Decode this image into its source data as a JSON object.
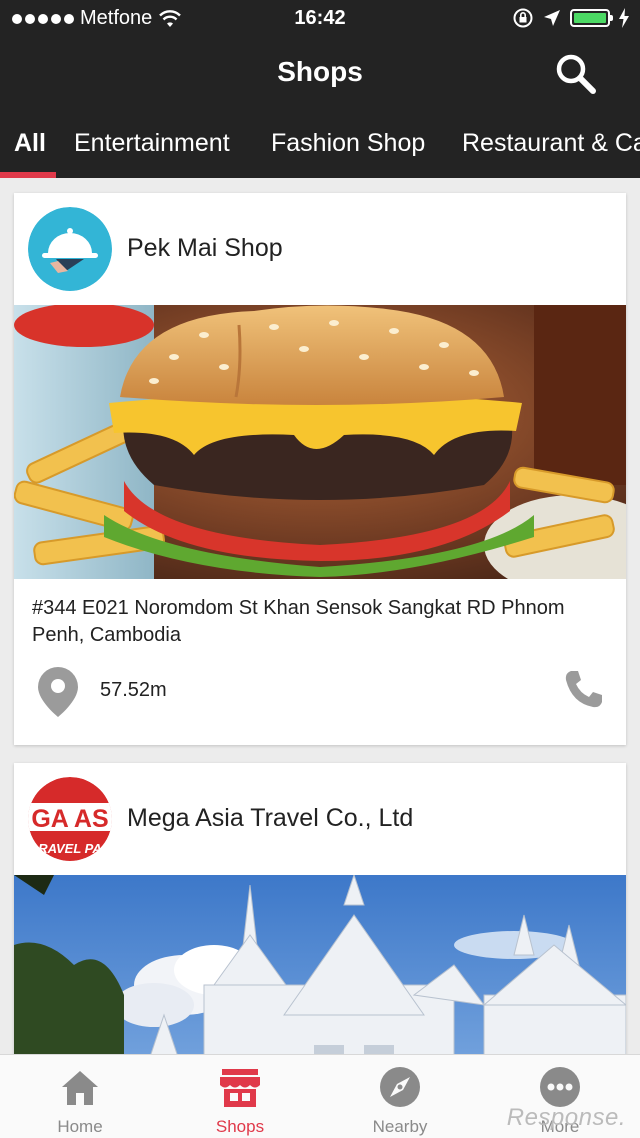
{
  "status_bar": {
    "carrier": "Metfone",
    "time": "16:42",
    "icons": [
      "signal-dots-icon",
      "wifi-icon",
      "orientation-lock-icon",
      "location-arrow-icon",
      "battery-icon",
      "charging-bolt-icon"
    ],
    "battery_level": 1.0
  },
  "header": {
    "title": "Shops",
    "search_icon": "search-icon"
  },
  "tabs": {
    "items": [
      {
        "label": "All",
        "active": true
      },
      {
        "label": "Entertainment",
        "active": false
      },
      {
        "label": "Fashion Shop",
        "active": false
      },
      {
        "label": "Restaurant & Ca",
        "active": false
      }
    ]
  },
  "shops": [
    {
      "name": "Pek Mai Shop",
      "logo": "food-service-cloche-icon",
      "image": "burger-photo",
      "address": "#344 E021 Noromdom St Khan Sensok Sangkat RD Phnom Penh, Cambodia",
      "distance": "57.52m",
      "pin_icon": "map-pin-icon",
      "phone_icon": "phone-icon"
    },
    {
      "name": "Mega Asia Travel Co., Ltd",
      "logo_text_top": "GA AS",
      "logo_text_bottom": "RAVEL PA",
      "image": "white-temple-photo"
    }
  ],
  "bottom_nav": {
    "items": [
      {
        "label": "Home",
        "icon": "home-icon",
        "active": false
      },
      {
        "label": "Shops",
        "icon": "shop-awning-icon",
        "active": true
      },
      {
        "label": "Nearby",
        "icon": "compass-icon",
        "active": false
      },
      {
        "label": "More",
        "icon": "more-dots-icon",
        "active": false
      }
    ]
  },
  "watermark": "Response.",
  "colors": {
    "bar_background": "#232323",
    "accent": "#e0394a",
    "inactive_nav": "#8a8a8a",
    "battery": "#4cd964"
  }
}
